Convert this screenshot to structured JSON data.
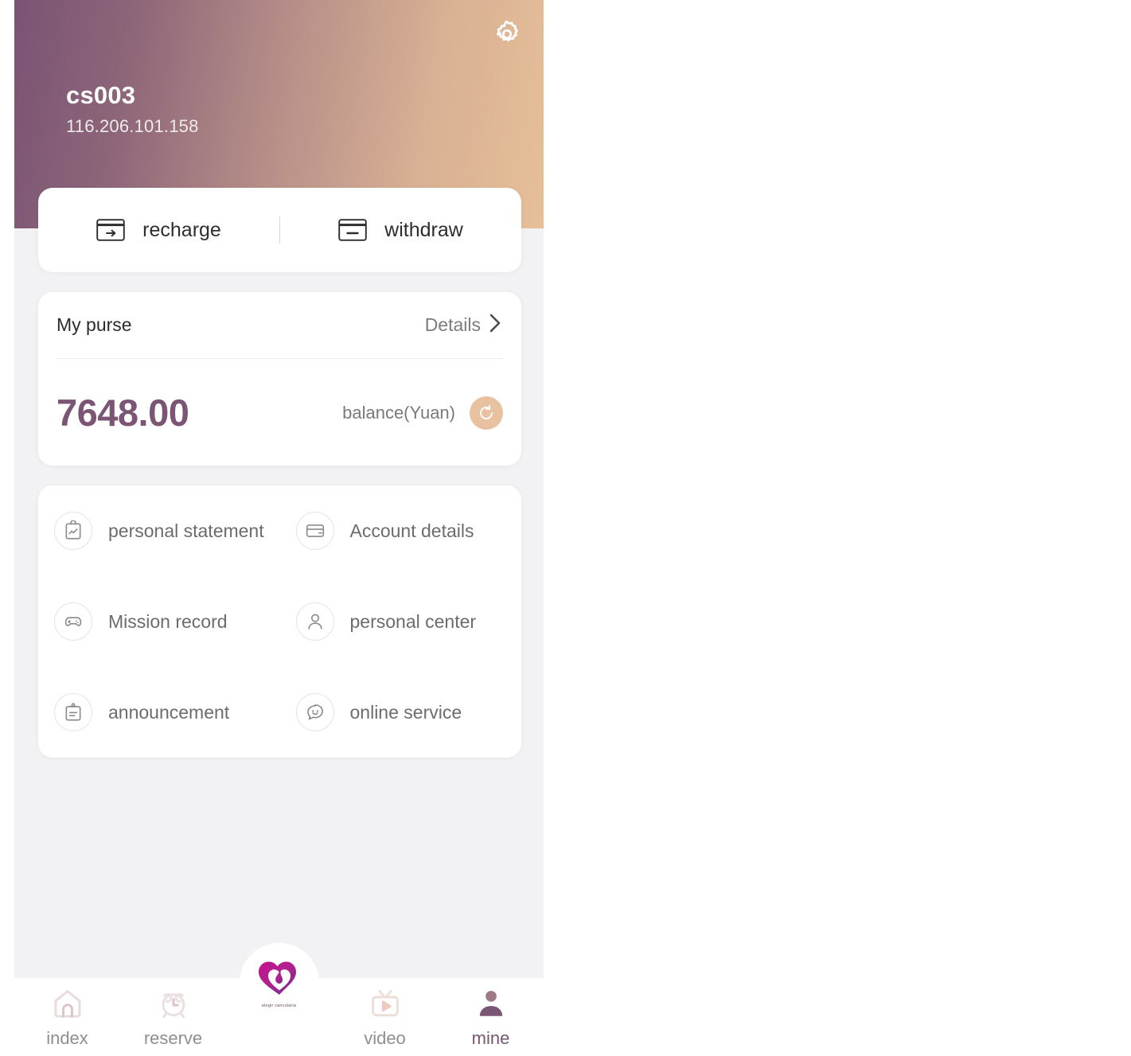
{
  "header": {
    "account_name": "cs003",
    "ip_address": "116.206.101.158",
    "gear_icon": "gear-icon",
    "gradient_from": "#7a5375",
    "gradient_to": "#e6bf98"
  },
  "actions": {
    "recharge": {
      "label": "recharge",
      "icon": "card-arrow-in-icon"
    },
    "withdraw": {
      "label": "withdraw",
      "icon": "card-minus-icon"
    }
  },
  "purse": {
    "title": "My purse",
    "details_label": "Details",
    "details_icon": "chevron-right-icon",
    "balance": "7648.00",
    "balance_label": "balance(Yuan)",
    "refresh_icon": "refresh-icon",
    "balance_color": "#7b5574",
    "refresh_bg": "#e8c2a0"
  },
  "menu": {
    "items": [
      {
        "label": "personal statement",
        "icon": "clipboard-chart-icon"
      },
      {
        "label": "Account details",
        "icon": "credit-card-icon"
      },
      {
        "label": "Mission record",
        "icon": "gamepad-icon"
      },
      {
        "label": "personal center",
        "icon": "person-icon"
      },
      {
        "label": "announcement",
        "icon": "clipboard-lines-icon"
      },
      {
        "label": "online service",
        "icon": "chat-smile-icon"
      }
    ]
  },
  "tabbar": {
    "items": [
      {
        "label": "index",
        "icon": "home-icon",
        "active": false
      },
      {
        "label": "reserve",
        "icon": "alarm-clock-icon",
        "active": false
      },
      {
        "label": "video",
        "icon": "tv-play-icon",
        "active": false
      },
      {
        "label": "mine",
        "icon": "person-filled-icon",
        "active": true
      }
    ],
    "center": {
      "icon": "heart-logo-icon",
      "caption": "elegir cancularia"
    },
    "active_color": "#7b5574",
    "inactive_color": "#8e8e93"
  }
}
